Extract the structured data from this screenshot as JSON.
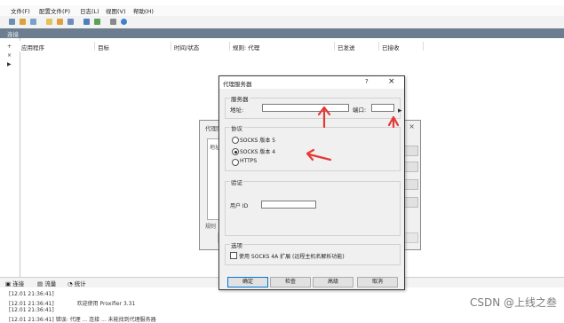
{
  "menu": {
    "items": [
      "文件(F)",
      "配置文件(P)",
      "日志(L)",
      "视图(V)",
      "帮助(H)"
    ]
  },
  "pane_header": "连接",
  "left_strip": [
    "+",
    "×",
    "▶"
  ],
  "columns": [
    "应用程序",
    "目标",
    "时间/状态",
    "规则: 代理",
    "已发送",
    "已接收"
  ],
  "bottom_tabs": [
    "连接",
    "流量",
    "统计"
  ],
  "log": {
    "lines": [
      {
        "time": "[12.01 21:36:41]",
        "msg": ""
      },
      {
        "time": "[12.01 21:36:41]",
        "msg": "欢迎使用 Proxifier 3.31"
      },
      {
        "time": "[12.01 21:36:41]",
        "msg": ""
      },
      {
        "time": "[12.01 21:36:41]",
        "msg": "错误: 代理 ... 连接 ... 未能找到代理服务器"
      }
    ]
  },
  "back_dialog": {
    "title": "代理服务器",
    "hint": "地址",
    "footer": "规则"
  },
  "proxy_dialog": {
    "title": "代理服务器",
    "help_symbol": "?",
    "close_symbol": "×",
    "server_group": "服务器",
    "address_label": "地址:",
    "address_value": "",
    "port_label": "端口:",
    "port_value": "",
    "protocol_group": "协议",
    "protocols": [
      {
        "label": "SOCKS 版本 5",
        "checked": false
      },
      {
        "label": "SOCKS 版本 4",
        "checked": true
      },
      {
        "label": "HTTPS",
        "checked": false
      }
    ],
    "auth_group": "验证",
    "userid_label": "用户 ID",
    "userid_value": "",
    "options_group": "选项",
    "option_label": "使用 SOCKS 4A 扩展 (远程主机名解析功能)",
    "option_checked": false,
    "buttons": [
      "确定",
      "检查",
      "高级",
      "取消"
    ]
  },
  "colors": {
    "pane_header": "#6b7d8f",
    "annotation_arrow": "#e53935",
    "dialog_bg": "#f0f0f0"
  },
  "watermark": "CSDN @上线之叁"
}
